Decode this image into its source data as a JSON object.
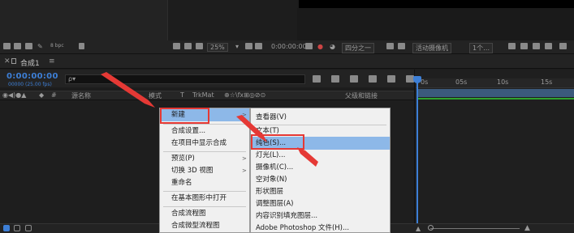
{
  "toolbar": {
    "bpc": "8 bpc",
    "zoom": "25%",
    "timecode": "0:00:00:00",
    "resolution": "四分之一",
    "camera": "活动摄像机",
    "views": "1个…"
  },
  "comp": {
    "tab_title": "合成1",
    "timecode": "0:00:00:00",
    "fps": "00000 (25.00 fps)",
    "search_placeholder": "ρ▾"
  },
  "columns": {
    "source_name": "源名称",
    "mode": "模式",
    "t": "T",
    "trkmat": "TrkMat",
    "parent": "父级和链接"
  },
  "ruler": {
    "ticks": [
      "0s",
      "05s",
      "10s",
      "15s"
    ]
  },
  "context_menu": {
    "items": [
      {
        "label": "新建",
        "submenu": true
      },
      {
        "label": "合成设置..."
      },
      {
        "label": "在项目中显示合成"
      },
      {
        "label": "预览(P)",
        "submenu": true
      },
      {
        "label": "切换 3D 视图",
        "submenu": true
      },
      {
        "label": "重命名"
      },
      {
        "label": "在基本图形中打开"
      },
      {
        "label": "合成流程图"
      },
      {
        "label": "合成微型流程图"
      }
    ]
  },
  "submenu": {
    "items": [
      {
        "label": "查看器(V)"
      },
      {
        "label": "文本(T)"
      },
      {
        "label": "纯色(S)..."
      },
      {
        "label": "灯光(L)..."
      },
      {
        "label": "摄像机(C)..."
      },
      {
        "label": "空对象(N)"
      },
      {
        "label": "形状图层"
      },
      {
        "label": "调整图层(A)"
      },
      {
        "label": "内容识别填充图层..."
      },
      {
        "label": "Adobe Photoshop 文件(H)..."
      }
    ]
  },
  "colors": {
    "accent_blue": "#3d7fd6",
    "highlight_red": "#e53935",
    "menu_bg": "#f0f0f0",
    "menu_highlight": "#8db8e8",
    "timeline_green": "#2fa32f"
  }
}
